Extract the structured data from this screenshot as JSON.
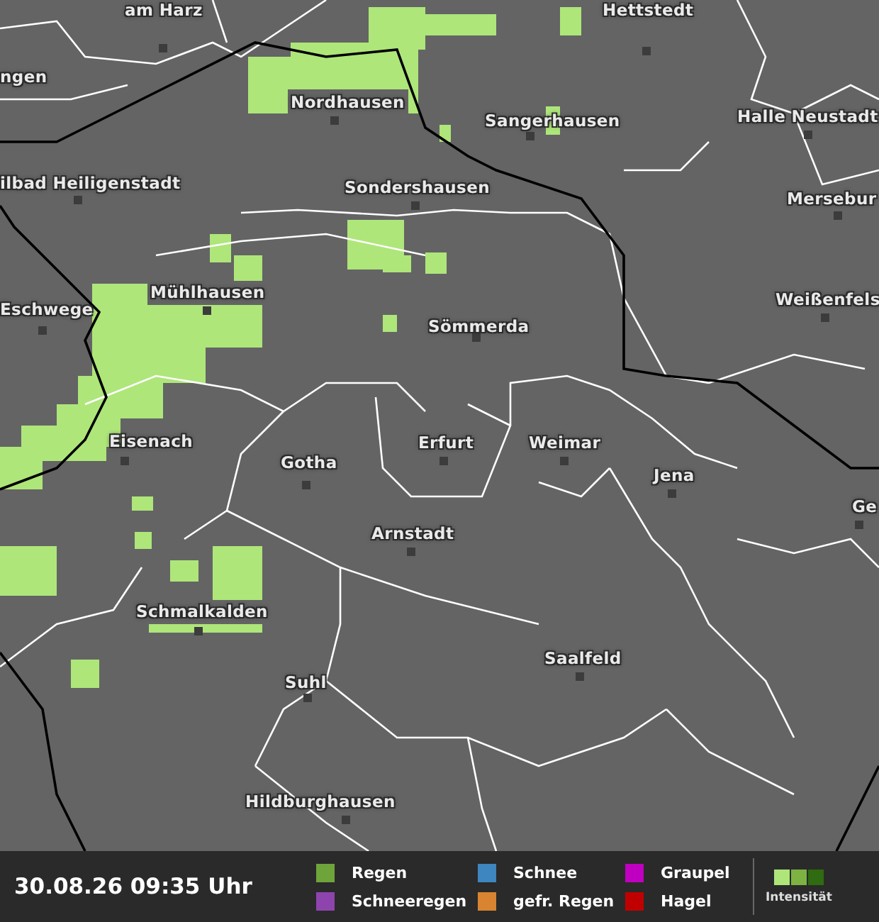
{
  "map": {
    "cities": [
      {
        "name": "am Harz"
      },
      {
        "name": "Hettstedt"
      },
      {
        "name": "ngen"
      },
      {
        "name": "Nordhausen"
      },
      {
        "name": "Sangerhausen"
      },
      {
        "name": "Halle Neustadt"
      },
      {
        "name": "ilbad Heiligenstadt"
      },
      {
        "name": "Sondershausen"
      },
      {
        "name": "Mersebur"
      },
      {
        "name": "Mühlhausen"
      },
      {
        "name": "Eschwege"
      },
      {
        "name": "Weißenfels"
      },
      {
        "name": "Sömmerda"
      },
      {
        "name": "Eisenach"
      },
      {
        "name": "Gotha"
      },
      {
        "name": "Erfurt"
      },
      {
        "name": "Weimar"
      },
      {
        "name": "Jena"
      },
      {
        "name": "Ge"
      },
      {
        "name": "Arnstadt"
      },
      {
        "name": "Schmalkalden"
      },
      {
        "name": "Saalfeld"
      },
      {
        "name": "Suhl"
      },
      {
        "name": "Hildburghausen"
      }
    ]
  },
  "footer": {
    "timestamp": "30.08.26 09:35 Uhr",
    "legend": [
      {
        "label": "Regen",
        "color": "#6fa43a"
      },
      {
        "label": "Schnee",
        "color": "#3d86bf"
      },
      {
        "label": "Graupel",
        "color": "#c000c0"
      },
      {
        "label": "Schneeregen",
        "color": "#8e44ad"
      },
      {
        "label": "gefr. Regen",
        "color": "#d88430"
      },
      {
        "label": "Hagel",
        "color": "#c00000"
      }
    ],
    "intensity": {
      "label": "Intensität"
    }
  }
}
